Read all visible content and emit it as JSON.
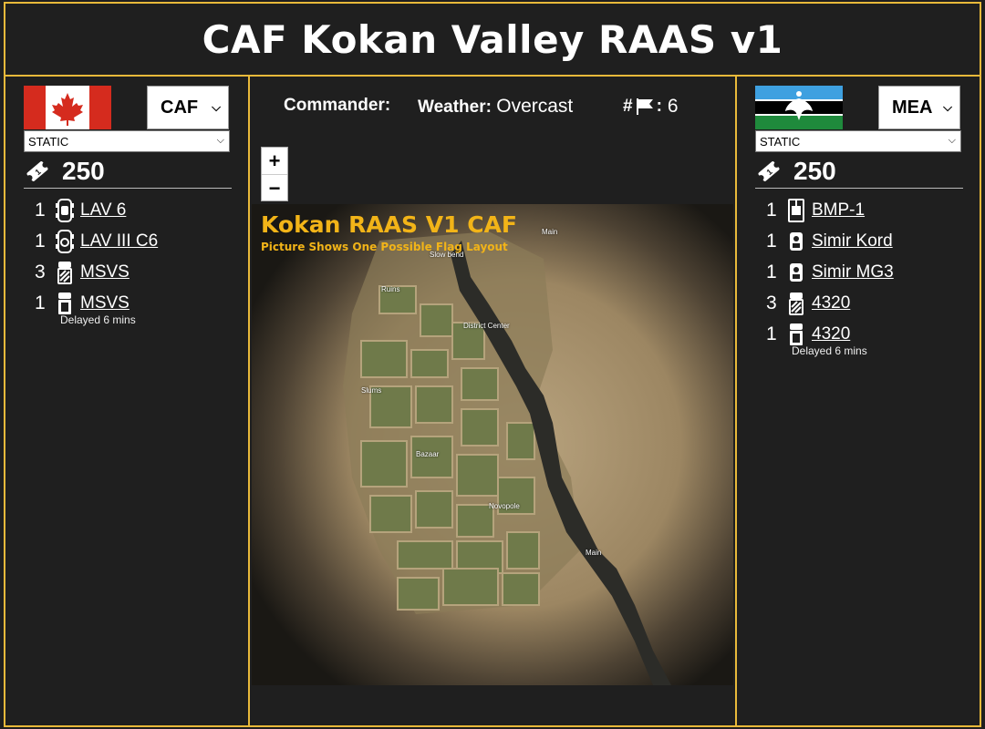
{
  "header": {
    "title": "CAF Kokan Valley RAAS v1"
  },
  "left_team": {
    "faction": "CAF",
    "layer_type": "STATIC",
    "tickets": "250",
    "vehicles": [
      {
        "count": "1",
        "name": "LAV 6",
        "icon": "wheeled-apc-icon",
        "note": ""
      },
      {
        "count": "1",
        "name": "LAV III C6",
        "icon": "wheeled-apc-icon",
        "note": ""
      },
      {
        "count": "3",
        "name": "MSVS",
        "icon": "logistics-truck-icon",
        "note": ""
      },
      {
        "count": "1",
        "name": "MSVS",
        "icon": "transport-truck-icon",
        "note": "Delayed 6 mins"
      }
    ]
  },
  "right_team": {
    "faction": "MEA",
    "layer_type": "STATIC",
    "tickets": "250",
    "vehicles": [
      {
        "count": "1",
        "name": "BMP-1",
        "icon": "ifv-icon",
        "note": ""
      },
      {
        "count": "1",
        "name": "Simir Kord",
        "icon": "mrap-hmg-icon",
        "note": ""
      },
      {
        "count": "1",
        "name": "Simir MG3",
        "icon": "mrap-mg-icon",
        "note": ""
      },
      {
        "count": "3",
        "name": "4320",
        "icon": "logistics-truck-icon",
        "note": ""
      },
      {
        "count": "1",
        "name": "4320",
        "icon": "transport-truck-icon",
        "note": "Delayed 6 mins"
      }
    ]
  },
  "info": {
    "commander_label": "Commander:",
    "commander_value": "",
    "weather_label": "Weather:",
    "weather_value": "Overcast",
    "flags_label": "#",
    "flags_sep": ":",
    "flags_count": "6"
  },
  "zoom": {
    "in": "+",
    "out": "−"
  },
  "map": {
    "title": "Kokan RAAS V1 CAF",
    "subtitle": "Picture Shows One Possible Flag Layout",
    "flags": [
      {
        "name": "Main"
      },
      {
        "name": "Slow bend"
      },
      {
        "name": "Ruins"
      },
      {
        "name": "District Center"
      },
      {
        "name": "Slums"
      },
      {
        "name": "Bazaar"
      },
      {
        "name": "Novopole"
      },
      {
        "name": "Main"
      }
    ]
  },
  "colors": {
    "border": "#e8b93a",
    "background": "#1f1f1f",
    "map_title": "#f2b418"
  }
}
